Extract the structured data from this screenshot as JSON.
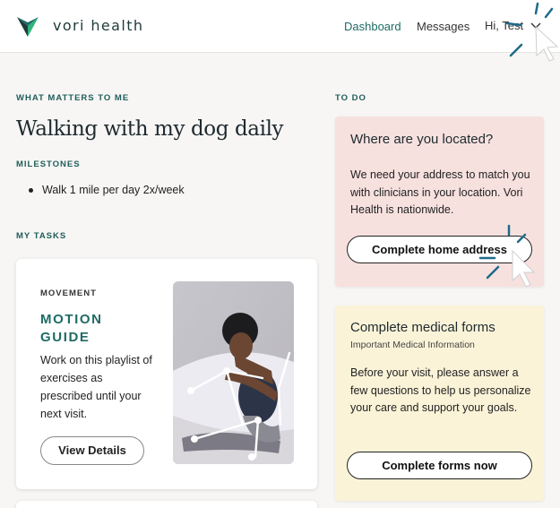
{
  "header": {
    "brand": "vori health",
    "nav": {
      "dashboard": "Dashboard",
      "messages": "Messages",
      "user_greeting": "Hi, Test"
    }
  },
  "colors": {
    "brand_teal": "#1f6b66",
    "logo_dark": "#1f3b3a",
    "logo_green": "#2fb57a",
    "todo_pink": "#f7e1df",
    "todo_yellow": "#fbf3d8",
    "page_bg": "#f7f6f4"
  },
  "left": {
    "what_matters_label": "WHAT MATTERS TO ME",
    "goal_title": "Walking with my dog daily",
    "milestones_label": "MILESTONES",
    "milestones": [
      "Walk 1 mile per day 2x/week"
    ],
    "my_tasks_label": "MY TASKS",
    "task": {
      "category": "MOVEMENT",
      "title": "MOTION GUIDE",
      "description": "Work on this playlist of exercises as prescribed until your next visit.",
      "button": "View Details",
      "image_icon": "stretching-person-photo"
    }
  },
  "right": {
    "todo_label": "TO DO",
    "cards": [
      {
        "title": "Where are you located?",
        "body": "We need your address to match you with clinicians in your location. Vori Health is nationwide.",
        "button": "Complete home address"
      },
      {
        "title": "Complete medical forms",
        "subtitle": "Important Medical Information",
        "body": "Before your visit, please answer a few questions to help us personalize your care and support your goals.",
        "button": "Complete forms now"
      }
    ]
  }
}
